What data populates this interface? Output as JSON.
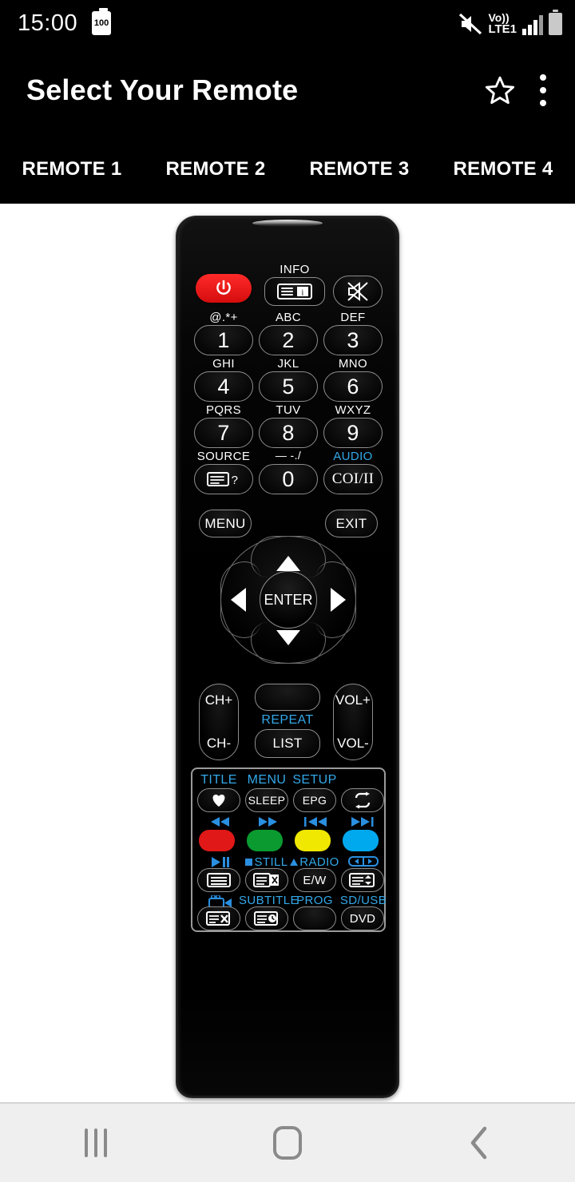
{
  "status_bar": {
    "time": "15:00",
    "battery_badge": "100",
    "network_line1": "Vo))",
    "network_line2": "LTE1",
    "icons": [
      "mute-icon",
      "volte-icon",
      "signal-bars-icon",
      "battery-icon"
    ]
  },
  "app_bar": {
    "title": "Select Your Remote",
    "favorite_icon": "star-icon",
    "overflow_icon": "more-vertical-icon"
  },
  "tabs": [
    {
      "label": "REMOTE 1",
      "selected": true
    },
    {
      "label": "REMOTE 2",
      "selected": false
    },
    {
      "label": "REMOTE 3",
      "selected": false
    },
    {
      "label": "REMOTE 4",
      "selected": false
    }
  ],
  "remote": {
    "power": {
      "icon": "power-icon",
      "color": "#e01818"
    },
    "top_row": {
      "info_label": "INFO",
      "info_icon": "info-display-icon",
      "mute_icon": "mute-speaker-icon"
    },
    "keypad": [
      {
        "top": "@.*+",
        "key": "1"
      },
      {
        "top": "ABC",
        "key": "2"
      },
      {
        "top": "DEF",
        "key": "3"
      },
      {
        "top": "GHI",
        "key": "4"
      },
      {
        "top": "JKL",
        "key": "5"
      },
      {
        "top": "MNO",
        "key": "6"
      },
      {
        "top": "PQRS",
        "key": "7"
      },
      {
        "top": "TUV",
        "key": "8"
      },
      {
        "top": "WXYZ",
        "key": "9"
      }
    ],
    "bottom_keypad_row": {
      "source_label": "SOURCE",
      "source_icon": "source-list-icon",
      "zero_top": "— -./",
      "zero_key": "0",
      "audio_label": "AUDIO",
      "audio_key": "COI/II"
    },
    "menu_button": "MENU",
    "exit_button": "EXIT",
    "dpad": {
      "center": "ENTER",
      "up": "up-arrow-icon",
      "down": "down-arrow-icon",
      "left": "left-arrow-icon",
      "right": "right-arrow-icon"
    },
    "rockers": {
      "channel_up": "CH+",
      "channel_down": "CH-",
      "volume_up": "VOL+",
      "volume_down": "VOL-"
    },
    "middle_column": {
      "blank_button": "",
      "repeat_label": "REPEAT",
      "list_button": "LIST"
    },
    "panel": {
      "row1": {
        "labels": [
          "TITLE",
          "MENU",
          "SETUP",
          ""
        ],
        "buttons": [
          {
            "icon": "heart-icon",
            "text": ""
          },
          {
            "icon": "",
            "text": "SLEEP"
          },
          {
            "icon": "",
            "text": "EPG"
          },
          {
            "icon": "repeat-loop-icon",
            "text": ""
          }
        ]
      },
      "row2": {
        "labels": [
          "rewind-icon",
          "fast-forward-icon",
          "skip-previous-icon",
          "skip-next-icon"
        ],
        "colors": [
          "#e01818",
          "#0a9a30",
          "#f0e800",
          "#00a8ee"
        ],
        "button_names": [
          "red-color-key",
          "green-color-key",
          "yellow-color-key",
          "blue-color-key"
        ]
      },
      "row3": {
        "labels": [
          "play-pause-icon",
          "STILL",
          "RADIO",
          "width-adjust-icon"
        ],
        "buttons": [
          {
            "icon": "text-lines-icon",
            "text": ""
          },
          {
            "icon": "teletext-mix-icon",
            "text": ""
          },
          {
            "icon": "",
            "text": "E/W"
          },
          {
            "icon": "list-updown-icon",
            "text": ""
          }
        ]
      },
      "row4": {
        "labels": [
          "camera-icon",
          "SUBTITLE",
          "PROG",
          "SD/USB"
        ],
        "buttons": [
          {
            "icon": "text-cancel-icon",
            "text": ""
          },
          {
            "icon": "text-clock-icon",
            "text": ""
          },
          {
            "icon": "",
            "text": ""
          },
          {
            "icon": "",
            "text": "DVD"
          }
        ]
      }
    }
  },
  "nav_bar": {
    "recents_icon": "recents-icon",
    "home_icon": "home-icon",
    "back_icon": "back-icon"
  },
  "colors": {
    "accent_blue": "#33a8e8",
    "power_red": "#e01818",
    "bar_background": "#000000",
    "page_background": "#ffffff",
    "nav_background": "#efefef"
  }
}
